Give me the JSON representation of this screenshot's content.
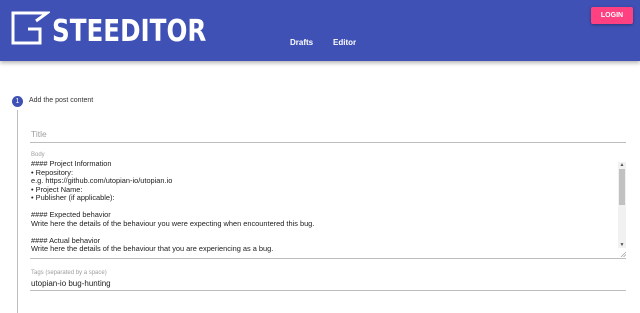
{
  "header": {
    "logo_text": "STEEDITOR",
    "nav": {
      "drafts_label": "Drafts",
      "editor_label": "Editor"
    },
    "login_label": "LOGIN"
  },
  "colors": {
    "primary": "#3f51b5",
    "accent": "#ff4081"
  },
  "step": {
    "number": "1",
    "label": "Add the post content"
  },
  "form": {
    "title": {
      "placeholder": "Title",
      "value": ""
    },
    "body": {
      "label": "Body",
      "lines": [
        "#### Project Information",
        "• Repository:",
        "e.g. https://github.com/utopian-io/utopian.io",
        "• Project Name:",
        "• Publisher (if applicable):",
        "",
        "#### Expected behavior",
        "Write here the details of the behaviour you were expecting when encountered this bug.",
        "",
        "#### Actual behavior",
        "Write here the details of the behaviour that you are experiencing as a bug."
      ]
    },
    "tags": {
      "label": "Tags (separated by a space)",
      "value": "utopian-io bug-hunting"
    }
  },
  "icons": {
    "scroll_up": "▲",
    "scroll_down": "▼"
  }
}
